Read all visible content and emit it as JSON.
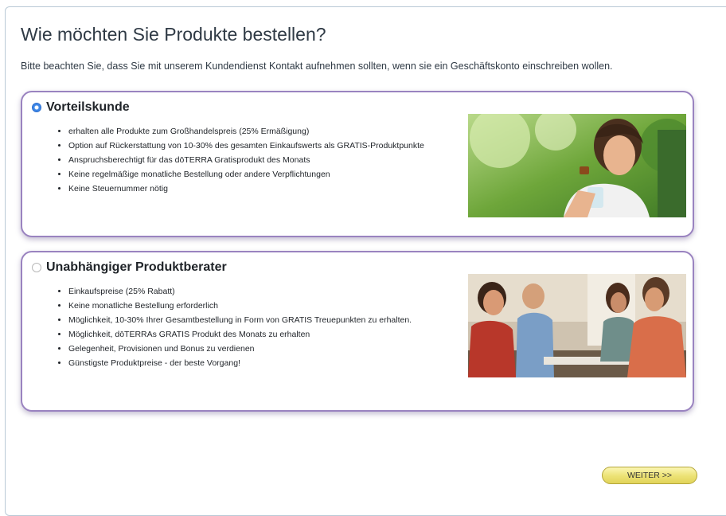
{
  "page": {
    "title": "Wie möchten Sie Produkte bestellen?",
    "note": "Bitte beachten Sie, dass Sie mit unserem Kundendienst Kontakt aufnehmen sollten, wenn sie ein Geschäftskonto einschreiben wollen."
  },
  "options": [
    {
      "title": "Vorteilskunde",
      "selected": true,
      "benefits": [
        "erhalten alle Produkte zum Großhandelspreis (25% Ermäßigung)",
        "Option auf Rückerstattung von 10-30% des gesamten Einkaufswerts als GRATIS-Produktpunkte",
        "Anspruchsberechtigt für das dōTERRA Gratisprodukt des Monats",
        "Keine regelmäßige monatliche Bestellung oder andere Verpflichtungen",
        "Keine Steuernummer nötig"
      ],
      "image": "woman-drinking-water-photo"
    },
    {
      "title": "Unabhängiger Produktberater",
      "selected": false,
      "benefits": [
        "Einkaufspreise (25% Rabatt)",
        "Keine monatliche Bestellung erforderlich",
        "Möglichkeit, 10-30% Ihrer Gesamtbestellung in Form von GRATIS Treuepunkten zu erhalten.",
        "Möglichkeit, dōTERRAs GRATIS Produkt des Monats zu erhalten",
        "Gelegenheit, Provisionen und Bonus zu verdienen",
        "Günstigste Produktpreise - der beste Vorgang!"
      ],
      "image": "group-of-people-photo"
    }
  ],
  "actions": {
    "next_label": "WEITER >>"
  },
  "colors": {
    "card_border": "#9a83c0",
    "radio_selected": "#3d86e6",
    "button_fill": "#ece274"
  }
}
